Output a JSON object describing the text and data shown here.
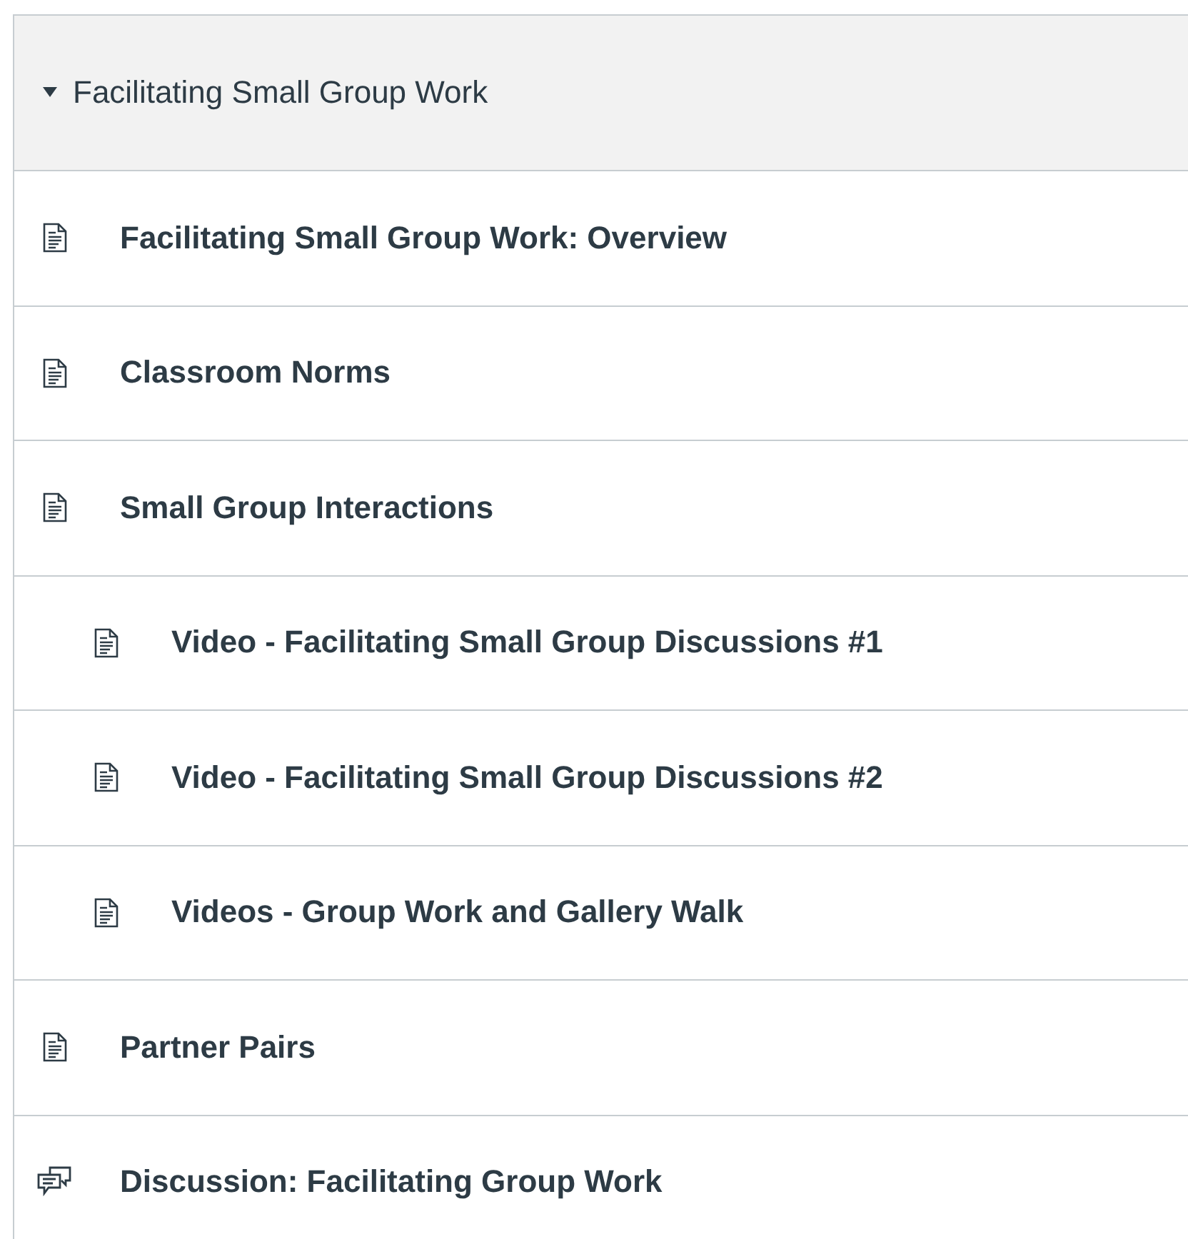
{
  "module": {
    "title": "Facilitating Small Group Work",
    "expanded": true,
    "items": [
      {
        "kind": "page",
        "title": "Facilitating Small Group Work: Overview"
      },
      {
        "kind": "page",
        "title": "Classroom Norms"
      },
      {
        "kind": "page",
        "title": "Small Group Interactions",
        "children": [
          {
            "kind": "page",
            "title": "Video - Facilitating Small Group Discussions #1"
          },
          {
            "kind": "page",
            "title": "Video - Facilitating Small Group Discussions #2"
          },
          {
            "kind": "page",
            "title": "Videos - Group Work and Gallery Walk"
          }
        ]
      },
      {
        "kind": "page",
        "title": "Partner Pairs"
      },
      {
        "kind": "discussion",
        "title": "Discussion: Facilitating Group Work"
      }
    ]
  }
}
